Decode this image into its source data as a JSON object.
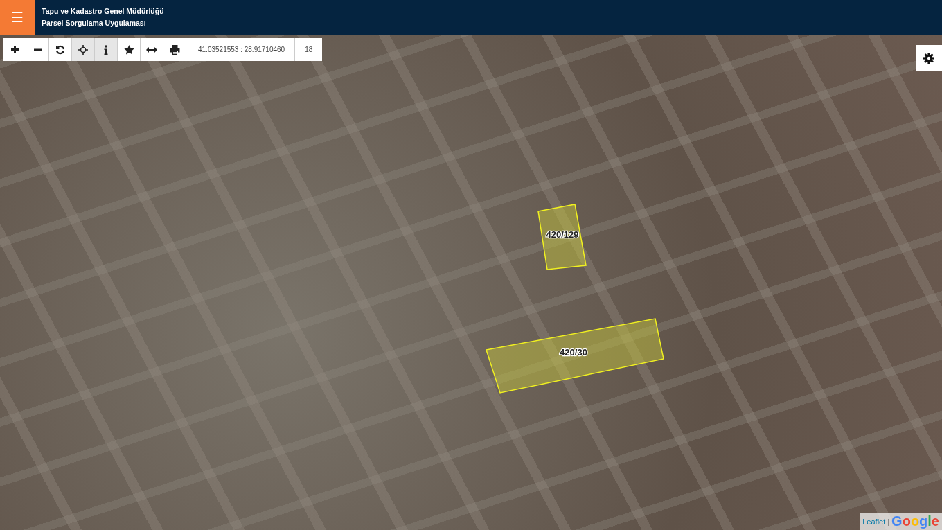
{
  "header": {
    "menu_icon": "☰",
    "title": "Tapu ve Kadastro Genel Müdürlüğü",
    "subtitle": "Parsel Sorgulama Uygulaması"
  },
  "toolbar": {
    "tools": [
      {
        "kind": "zoom-in",
        "active": false
      },
      {
        "kind": "zoom-out",
        "active": false
      },
      {
        "kind": "refresh",
        "active": false
      },
      {
        "kind": "locate",
        "active": true
      },
      {
        "kind": "info",
        "active": true
      },
      {
        "kind": "favorite",
        "active": false
      },
      {
        "kind": "measure",
        "active": false
      },
      {
        "kind": "print",
        "active": false
      }
    ],
    "coordinates": "41.03521553 : 28.91710460",
    "zoom": "18"
  },
  "parcels": [
    {
      "label": "420/129"
    },
    {
      "label": "420/30"
    }
  ],
  "attribution": {
    "link": "Leaflet",
    "separator": "|",
    "logo": "Google"
  }
}
